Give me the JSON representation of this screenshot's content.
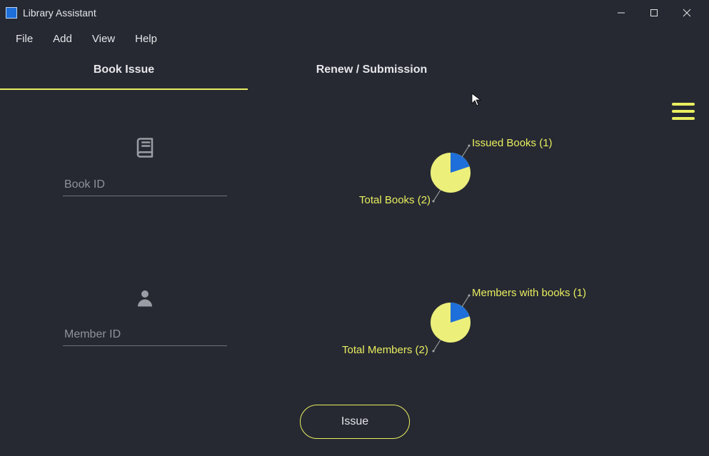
{
  "window": {
    "title": "Library Assistant"
  },
  "menu": {
    "items": [
      "File",
      "Add",
      "View",
      "Help"
    ]
  },
  "tabs": {
    "items": [
      {
        "label": "Book Issue",
        "active": true
      },
      {
        "label": "Renew / Submission",
        "active": false
      }
    ]
  },
  "form": {
    "book_id": {
      "placeholder": "Book ID",
      "value": ""
    },
    "member_id": {
      "placeholder": "Member ID",
      "value": ""
    },
    "issue_button": "Issue"
  },
  "colors": {
    "accent": "#e9ee5f",
    "pie_main": "#ecef7a",
    "pie_slice": "#1e6fd9",
    "background": "#262932"
  },
  "chart_data": [
    {
      "type": "pie",
      "title": "",
      "series": [
        {
          "name": "Issued Books",
          "value": 1
        },
        {
          "name": "Total Books",
          "value": 2
        }
      ],
      "labels": {
        "slice": "Issued Books (1)",
        "total": "Total Books (2)"
      }
    },
    {
      "type": "pie",
      "title": "",
      "series": [
        {
          "name": "Members with books",
          "value": 1
        },
        {
          "name": "Total Members",
          "value": 2
        }
      ],
      "labels": {
        "slice": "Members with books (1)",
        "total": "Total Members (2)"
      }
    }
  ]
}
